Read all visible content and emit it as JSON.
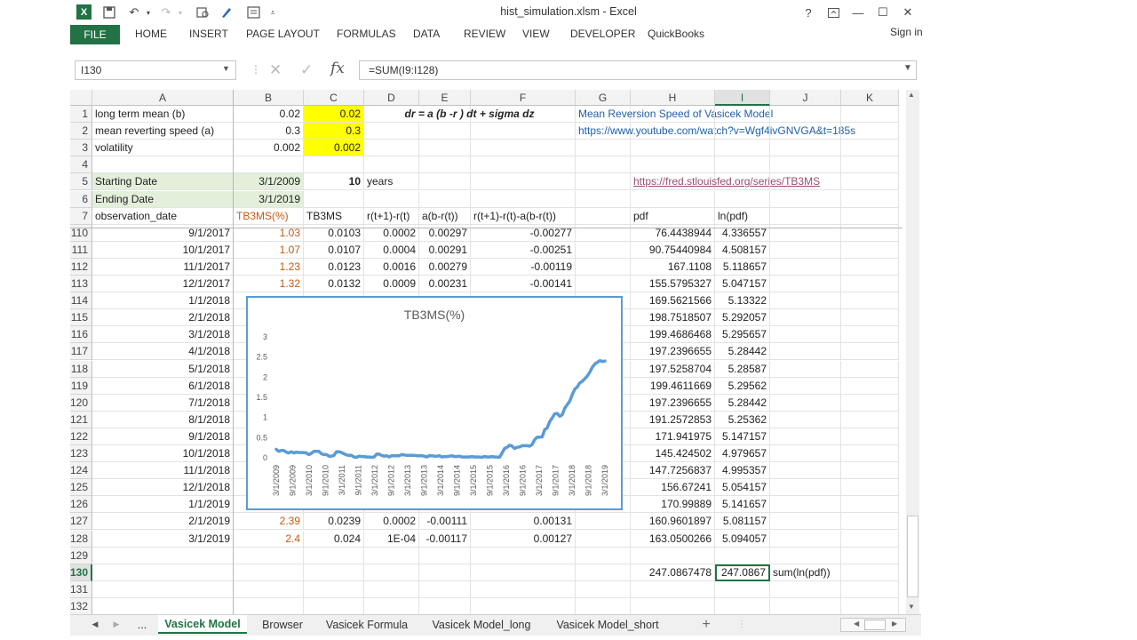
{
  "window": {
    "title": "hist_simulation.xlsm - Excel",
    "help": "?",
    "minimize": "—",
    "maximize": "☐",
    "close": "✕"
  },
  "ribbon": {
    "file": "FILE",
    "tabs": [
      "HOME",
      "INSERT",
      "PAGE LAYOUT",
      "FORMULAS",
      "DATA",
      "REVIEW",
      "VIEW",
      "DEVELOPER",
      "QuickBooks"
    ],
    "signin": "Sign in"
  },
  "formula_bar": {
    "name_box": "I130",
    "fx": "fx",
    "formula": "=SUM(I9:I128)"
  },
  "columns": [
    "A",
    "B",
    "C",
    "D",
    "E",
    "F",
    "G",
    "H",
    "I",
    "J",
    "K"
  ],
  "selected_column": "I",
  "selected_row": "130",
  "header_rows": [
    {
      "num": "1",
      "A": "long term mean (b)",
      "B": "0.02",
      "C": "0.02",
      "D": "dr = a (b -r ) dt + sigma dz",
      "G": "Mean Reversion Speed of Vasicek Model"
    },
    {
      "num": "2",
      "A": "mean reverting speed (a)",
      "B": "0.3",
      "C": "0.3",
      "G": "https://www.youtube.com/watch?v=Wgf4ivGNVGA&t=185s"
    },
    {
      "num": "3",
      "A": "volatility",
      "B": "0.002",
      "C": "0.002"
    },
    {
      "num": "4"
    },
    {
      "num": "5",
      "A": "Starting Date",
      "B": "3/1/2009",
      "C": "10",
      "D": "years",
      "H": "https://fred.stlouisfed.org/series/TB3MS"
    },
    {
      "num": "6",
      "A": "Ending Date",
      "B": "3/1/2019"
    },
    {
      "num": "7",
      "A": "observation_date",
      "B": "TB3MS(%)",
      "C": "TB3MS",
      "D": "r(t+1)-r(t)",
      "E": "a(b-r(t))",
      "F": "r(t+1)-r(t)-a(b-r(t))",
      "H": "pdf",
      "I": "ln(pdf)"
    }
  ],
  "data_rows": [
    {
      "num": "110",
      "A": "9/1/2017",
      "B": "1.03",
      "C": "0.0103",
      "D": "0.0002",
      "E": "0.00297",
      "F": "-0.00277",
      "H": "76.4438944",
      "I": "4.336557"
    },
    {
      "num": "111",
      "A": "10/1/2017",
      "B": "1.07",
      "C": "0.0107",
      "D": "0.0004",
      "E": "0.00291",
      "F": "-0.00251",
      "H": "90.75440984",
      "I": "4.508157"
    },
    {
      "num": "112",
      "A": "11/1/2017",
      "B": "1.23",
      "C": "0.0123",
      "D": "0.0016",
      "E": "0.00279",
      "F": "-0.00119",
      "H": "167.1108",
      "I": "5.118657"
    },
    {
      "num": "113",
      "A": "12/1/2017",
      "B": "1.32",
      "C": "0.0132",
      "D": "0.0009",
      "E": "0.00231",
      "F": "-0.00141",
      "H": "155.5795327",
      "I": "5.047157"
    },
    {
      "num": "114",
      "A": "1/1/2018",
      "H": "169.5621566",
      "I": "5.13322"
    },
    {
      "num": "115",
      "A": "2/1/2018",
      "H": "198.7518507",
      "I": "5.292057"
    },
    {
      "num": "116",
      "A": "3/1/2018",
      "H": "199.4686468",
      "I": "5.295657"
    },
    {
      "num": "117",
      "A": "4/1/2018",
      "H": "197.2396655",
      "I": "5.28442"
    },
    {
      "num": "118",
      "A": "5/1/2018",
      "H": "197.5258704",
      "I": "5.28587"
    },
    {
      "num": "119",
      "A": "6/1/2018",
      "H": "199.4611669",
      "I": "5.29562"
    },
    {
      "num": "120",
      "A": "7/1/2018",
      "H": "197.2396655",
      "I": "5.28442"
    },
    {
      "num": "121",
      "A": "8/1/2018",
      "H": "191.2572853",
      "I": "5.25362"
    },
    {
      "num": "122",
      "A": "9/1/2018",
      "H": "171.941975",
      "I": "5.147157"
    },
    {
      "num": "123",
      "A": "10/1/2018",
      "H": "145.424502",
      "I": "4.979657"
    },
    {
      "num": "124",
      "A": "11/1/2018",
      "H": "147.7256837",
      "I": "4.995357"
    },
    {
      "num": "125",
      "A": "12/1/2018",
      "H": "156.67241",
      "I": "5.054157"
    },
    {
      "num": "126",
      "A": "1/1/2019",
      "H": "170.99889",
      "I": "5.141657"
    },
    {
      "num": "127",
      "A": "2/1/2019",
      "B": "2.39",
      "C": "0.0239",
      "D": "0.0002",
      "E": "-0.00111",
      "F": "0.00131",
      "H": "160.9601897",
      "I": "5.081157"
    },
    {
      "num": "128",
      "A": "3/1/2019",
      "B": "2.4",
      "C": "0.024",
      "D": "1E-04",
      "E": "-0.00117",
      "F": "0.00127",
      "H": "163.0500266",
      "I": "5.094057"
    },
    {
      "num": "129"
    },
    {
      "num": "130",
      "H": "247.0867478",
      "I": "247.0867",
      "J": "sum(ln(pdf))"
    },
    {
      "num": "131"
    },
    {
      "num": "132"
    }
  ],
  "colors": {
    "excel_green": "#217346",
    "yellow": "#ffff00",
    "light_green": "#e2efda",
    "orange_text": "#c65911",
    "link_blue": "#1f5fa8",
    "chart_line": "#5b9bd5"
  },
  "chart_data": {
    "type": "line",
    "title": "TB3MS(%)",
    "xlabel": "",
    "ylabel": "",
    "ylim": [
      0,
      3
    ],
    "yticks": [
      "0",
      "0.5",
      "1",
      "1.5",
      "2",
      "2.5",
      "3"
    ],
    "xtick_labels": [
      "3/1/2009",
      "9/1/2009",
      "3/1/2010",
      "9/1/2010",
      "3/1/2011",
      "9/1/2011",
      "3/1/2012",
      "9/1/2012",
      "3/1/2013",
      "9/1/2013",
      "3/1/2014",
      "9/1/2014",
      "3/1/2015",
      "9/1/2015",
      "3/1/2016",
      "9/1/2016",
      "3/1/2017",
      "9/1/2017",
      "3/1/2018",
      "9/1/2018",
      "3/1/2019"
    ],
    "series": [
      {
        "values": [
          0.21,
          0.16,
          0.18,
          0.18,
          0.14,
          0.12,
          0.15,
          0.12,
          0.14,
          0.13,
          0.13,
          0.13,
          0.12,
          0.08,
          0.11,
          0.16,
          0.16,
          0.16,
          0.1,
          0.08,
          0.08,
          0.04,
          0.04,
          0.06,
          0.15,
          0.15,
          0.13,
          0.1,
          0.07,
          0.06,
          0.06,
          0.02,
          0.01,
          0.04,
          0.03,
          0.03,
          0.02,
          0.02,
          0.01,
          0.02,
          0.09,
          0.09,
          0.06,
          0.04,
          0.05,
          0.02,
          0.05,
          0.05,
          0.05,
          0.05,
          0.08,
          0.07,
          0.06,
          0.06,
          0.06,
          0.06,
          0.05,
          0.05,
          0.05,
          0.04,
          0.02,
          0.05,
          0.05,
          0.04,
          0.04,
          0.05,
          0.02,
          0.03,
          0.03,
          0.04,
          0.05,
          0.03,
          0.03,
          0.04,
          0.02,
          0.02,
          0.02,
          0.02,
          0.03,
          0.02,
          0.02,
          0.02,
          0.01,
          0.03,
          0.02,
          0.02,
          0.03,
          0.02,
          0.02,
          0.01,
          0.12,
          0.23,
          0.26,
          0.31,
          0.29,
          0.23,
          0.26,
          0.27,
          0.3,
          0.3,
          0.3,
          0.29,
          0.33,
          0.45,
          0.51,
          0.51,
          0.52,
          0.7,
          0.74,
          0.9,
          0.99,
          1.09,
          1.1,
          1.03,
          1.07,
          1.23,
          1.32,
          1.41,
          1.57,
          1.7,
          1.76,
          1.86,
          1.9,
          1.96,
          2.03,
          2.13,
          2.25,
          2.33,
          2.37,
          2.41,
          2.39,
          2.4
        ]
      }
    ]
  },
  "sheet_tabs": {
    "nav_prev": "◀",
    "nav_next": "▶",
    "more": "...",
    "tabs": [
      "Vasicek Model",
      "Browser",
      "Vasicek Formula",
      "Vasicek Model_long",
      "Vasicek Model_short"
    ],
    "active": 0,
    "add": "+"
  }
}
